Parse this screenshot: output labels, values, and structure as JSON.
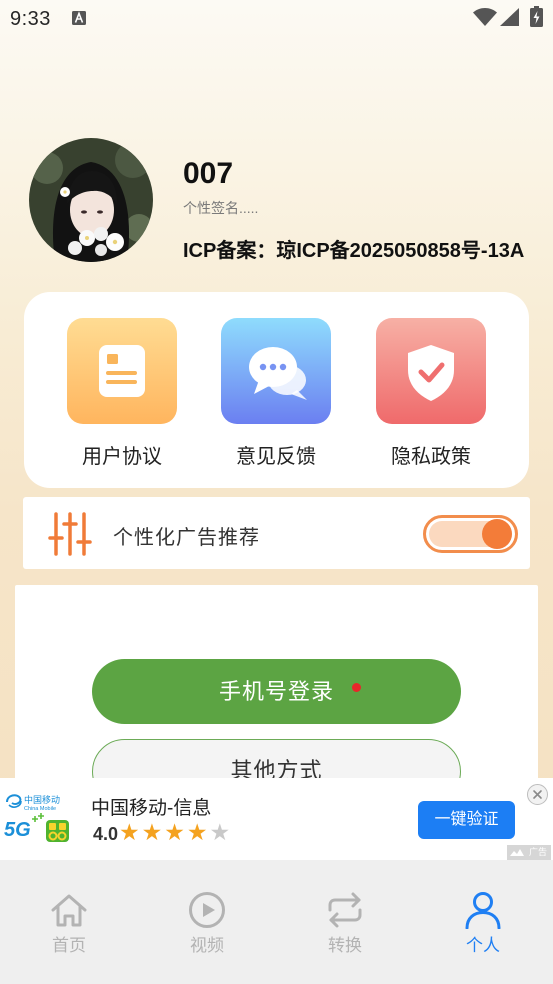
{
  "status_bar": {
    "time": "9:33",
    "icons": [
      "a-notification-icon",
      "wifi-icon",
      "signal-icon",
      "battery-charging-icon"
    ]
  },
  "profile": {
    "name": "007",
    "signature": "个性签名.....",
    "icp": "ICP备案：琼ICP备2025050858号-13A",
    "avatar_icon": "avatar-photo"
  },
  "shortcuts": [
    {
      "label": "用户协议",
      "icon": "document-icon"
    },
    {
      "label": "意见反馈",
      "icon": "chat-icon"
    },
    {
      "label": "隐私政策",
      "icon": "shield-check-icon"
    }
  ],
  "ad_setting": {
    "label": "个性化广告推荐",
    "icon": "sliders-icon",
    "enabled": true
  },
  "login": {
    "phone_label": "手机号登录",
    "other_label": "其他方式"
  },
  "ad_banner": {
    "logo": {
      "cn": "中国移动",
      "en": "China Mobile",
      "badge": "5G"
    },
    "title": "中国移动-信息",
    "rating": "4.0",
    "stars_filled": 4,
    "stars_total": 5,
    "button": "一键验证",
    "tag": "广告"
  },
  "nav": [
    {
      "label": "首页",
      "icon": "home-icon",
      "active": false
    },
    {
      "label": "视频",
      "icon": "play-icon",
      "active": false
    },
    {
      "label": "转换",
      "icon": "repeat-icon",
      "active": false
    },
    {
      "label": "个人",
      "icon": "person-icon",
      "active": true
    }
  ],
  "colors": {
    "accent_orange": "#f07b38",
    "login_green": "#5ca443",
    "nav_active": "#1f7ff3",
    "nav_inactive": "#b3b3b3",
    "ad_button": "#1c7ef4"
  }
}
